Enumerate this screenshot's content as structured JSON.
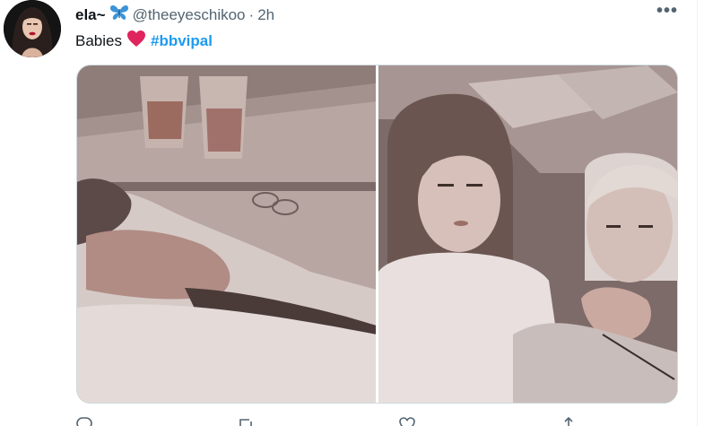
{
  "tweet": {
    "display_name": "ela~",
    "name_emoji_icon": "butterfly-icon",
    "handle": "@theeyeschikoo",
    "separator": "·",
    "timestamp": "2h",
    "more_icon": "more-horizontal-icon",
    "more_label": "•••",
    "text_before": "Babies",
    "text_emoji_icon": "red-heart-icon",
    "hashtag": "#bbvipal",
    "media": [
      {
        "icon": "photo-sleeping-person"
      },
      {
        "icon": "photo-couple-in-bed"
      }
    ],
    "actions": [
      {
        "icon": "reply-icon"
      },
      {
        "icon": "retweet-icon"
      },
      {
        "icon": "like-icon"
      },
      {
        "icon": "share-icon"
      }
    ]
  },
  "colors": {
    "text_primary": "#0f1419",
    "text_secondary": "#536471",
    "link_blue": "#1d9bf0",
    "heart_red": "#e0245e",
    "butterfly_blue": "#3b94d9",
    "border": "#cfd9de"
  }
}
